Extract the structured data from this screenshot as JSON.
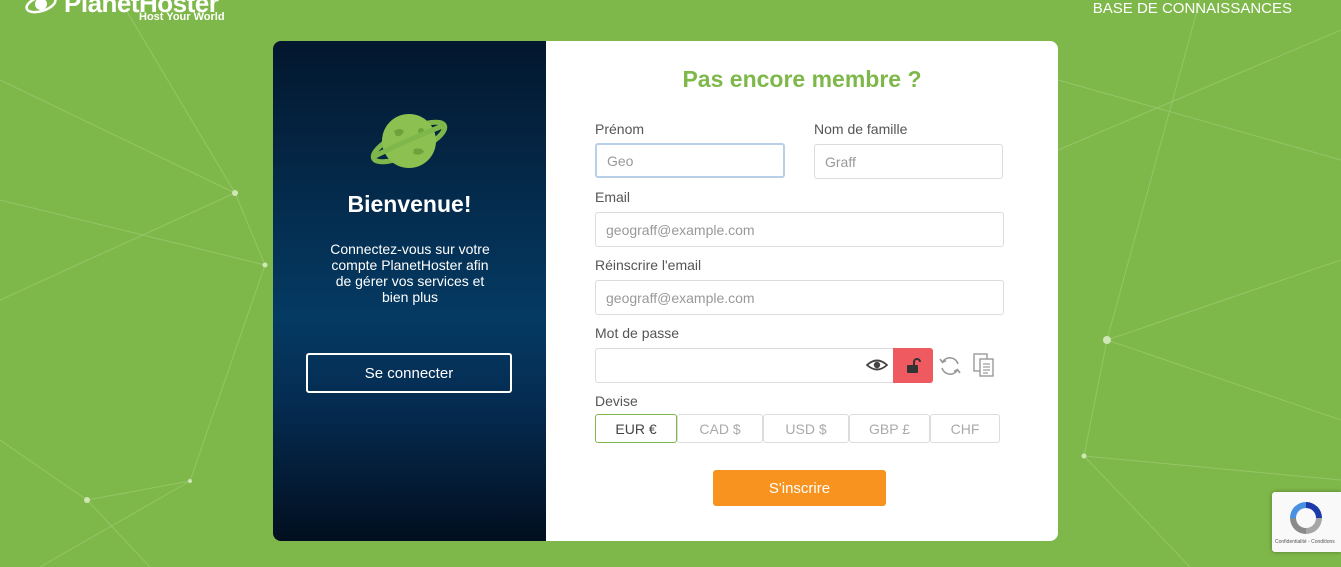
{
  "header": {
    "brand": "PlanetHoster",
    "tagline": "Host Your World",
    "kb_link": "BASE DE CONNAISSANCES"
  },
  "welcome": {
    "title": "Bienvenue!",
    "text": "Connectez-vous sur votre compte PlanetHoster afin de gérer vos services et bien plus",
    "login_label": "Se connecter"
  },
  "form": {
    "title": "Pas encore membre ?",
    "first_name": {
      "label": "Prénom",
      "value": "",
      "placeholder": "Geo"
    },
    "last_name": {
      "label": "Nom de famille",
      "value": "",
      "placeholder": "Graff"
    },
    "email": {
      "label": "Email",
      "value": "",
      "placeholder": "geograff@example.com"
    },
    "email_confirm": {
      "label": "Réinscrire l'email",
      "value": "",
      "placeholder": "geograff@example.com"
    },
    "password": {
      "label": "Mot de passe",
      "value": ""
    },
    "currency": {
      "label": "Devise",
      "options": [
        "EUR €",
        "CAD $",
        "USD $",
        "GBP £",
        "CHF"
      ],
      "selected": "EUR €"
    },
    "submit_label": "S'inscrire"
  },
  "recaptcha": {
    "text": "Confidentialité - Conditions"
  },
  "icons": {
    "password_toggle": "eye-icon",
    "lock": "unlock-icon",
    "generate": "refresh-icon",
    "copy": "copy-icon",
    "planet": "planet-icon"
  },
  "colors": {
    "background": "#7fb84a",
    "accent_green": "#7fb84a",
    "signup_orange": "#f7931e",
    "lock_red": "#ee5a5f",
    "panel_navy": "#053a63"
  }
}
